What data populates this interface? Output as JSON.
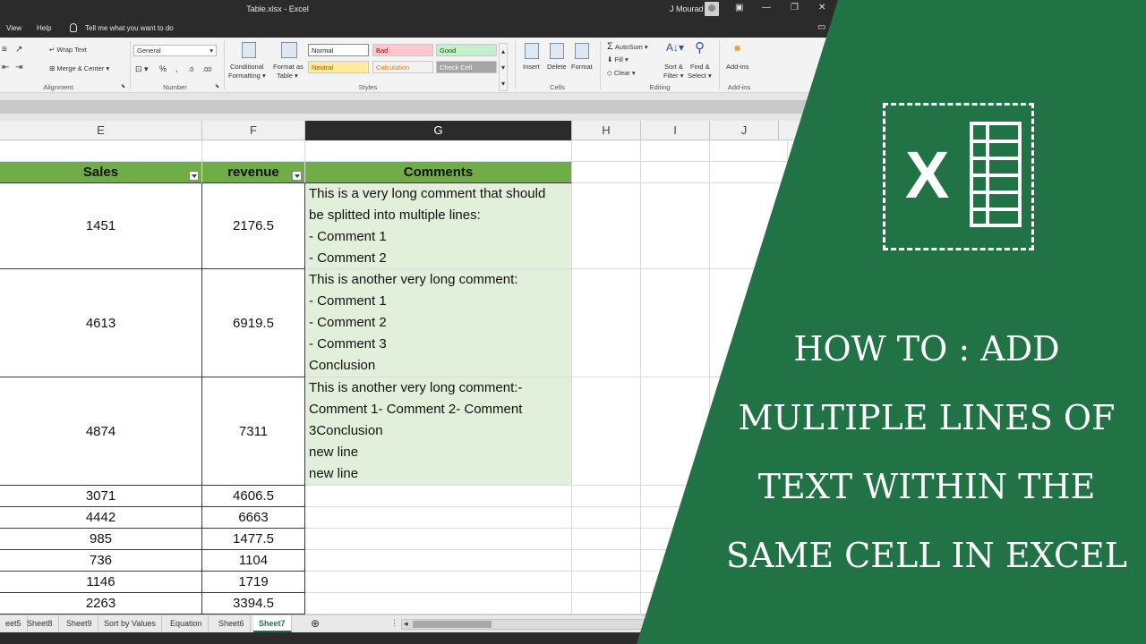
{
  "window": {
    "title": "Table.xlsx  -  Excel",
    "user": "J Mourad",
    "controls": [
      "▣",
      "—",
      "❐",
      "✕"
    ]
  },
  "menu": {
    "items": [
      "View",
      "Help"
    ],
    "tell_me": "Tell me what you want to do"
  },
  "ribbon": {
    "alignment": {
      "wrap_text": "Wrap Text",
      "merge_center": "Merge & Center",
      "label": "Alignment"
    },
    "number": {
      "format": "General",
      "percent": "%",
      "comma": ",",
      "label": "Number"
    },
    "styles": {
      "conditional": [
        "Conditional",
        "Formatting"
      ],
      "format_as_table": [
        "Format as",
        "Table"
      ],
      "cells": [
        {
          "name": "Normal",
          "bg": "#ffffff",
          "fg": "#222222"
        },
        {
          "name": "Bad",
          "bg": "#ffc7ce",
          "fg": "#9c0006"
        },
        {
          "name": "Good",
          "bg": "#c6efce",
          "fg": "#006100"
        },
        {
          "name": "Neutral",
          "bg": "#ffeb9c",
          "fg": "#9c5700"
        },
        {
          "name": "Calculation",
          "bg": "#f2f2f2",
          "fg": "#fa7d00"
        },
        {
          "name": "Check Cell",
          "bg": "#a5a5a5",
          "fg": "#ffffff"
        }
      ],
      "label": "Styles"
    },
    "cells": {
      "insert": "Insert",
      "delete": "Delete",
      "format": "Format",
      "label": "Cells"
    },
    "editing": {
      "autosum": "AutoSum",
      "fill": "Fill",
      "clear": "Clear",
      "sort_filter": [
        "Sort &",
        "Filter"
      ],
      "find_select": [
        "Find &",
        "Select"
      ],
      "label": "Editing"
    },
    "addins": {
      "button": "Add-ins",
      "label": "Add-ins"
    }
  },
  "columns": [
    "E",
    "F",
    "G",
    "H",
    "I",
    "J"
  ],
  "table": {
    "headers": {
      "sales": "Sales",
      "revenue": "revenue",
      "comments": "Comments"
    },
    "rows": [
      {
        "sales": "1451",
        "revenue": "2176.5"
      },
      {
        "sales": "4613",
        "revenue": "6919.5"
      },
      {
        "sales": "4874",
        "revenue": "7311"
      },
      {
        "sales": "3071",
        "revenue": "4606.5"
      },
      {
        "sales": "4442",
        "revenue": "6663"
      },
      {
        "sales": "985",
        "revenue": "1477.5"
      },
      {
        "sales": "736",
        "revenue": "1104"
      },
      {
        "sales": "1146",
        "revenue": "1719"
      },
      {
        "sales": "2263",
        "revenue": "3394.5"
      }
    ],
    "comments": [
      [
        "This is a very long comment that should",
        "be splitted into multiple lines:",
        "- Comment 1",
        "- Comment 2"
      ],
      [
        "This is another very long comment:",
        "- Comment 1",
        "- Comment 2",
        "- Comment 3",
        "Conclusion"
      ],
      [
        "This is another very long comment:-",
        "Comment 1- Comment 2- Comment",
        "3Conclusion",
        "new line",
        "new line"
      ]
    ]
  },
  "sheets": {
    "tabs": [
      "eet5",
      "Sheet8",
      "Sheet9",
      "Sort by Values",
      "Equation",
      "Sheet6",
      "Sheet7"
    ],
    "active": "Sheet7",
    "add": "⊕"
  },
  "overlay": {
    "logo_letter": "X",
    "headline": [
      "HOW TO : ADD",
      "MULTIPLE LINES OF",
      "TEXT WITHIN THE",
      "SAME CELL IN EXCEL"
    ],
    "green": "#217346",
    "accent": "#70ad47",
    "comment_fill": "#e2efda"
  }
}
